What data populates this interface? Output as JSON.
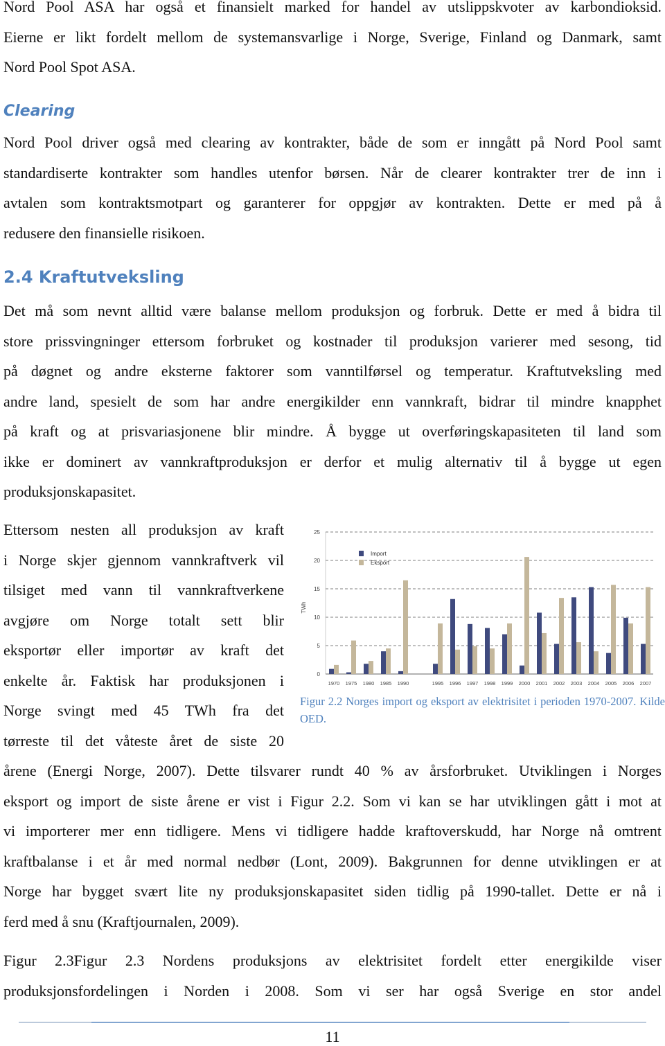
{
  "paragraphs": {
    "p1": [
      "Nord Pool ASA har også et finansielt marked for handel av utslippskvoter av karbondioksid.",
      "Eierne er likt fordelt mellom de systemansvarlige i Norge, Sverige, Finland og Danmark, samt",
      "Nord Pool Spot ASA."
    ],
    "h_clearing": "Clearing",
    "p2": [
      "Nord Pool driver også med clearing av kontrakter, både de som er inngått på Nord Pool samt",
      "standardiserte kontrakter som handles utenfor børsen. Når de clearer kontrakter trer de inn i",
      "avtalen som kontraktsmotpart og garanterer for oppgjør av kontrakten. Dette er med på å",
      "redusere den finansielle risikoen."
    ],
    "h_section": "2.4 Kraftutveksling",
    "p3": [
      "Det må som nevnt alltid være balanse mellom produksjon og forbruk. Dette er med å bidra til",
      "store prissvingninger ettersom forbruket og kostnader til produksjon varierer med sesong, tid",
      "på døgnet og andre eksterne faktorer som vanntilførsel og temperatur. Kraftutveksling med",
      "andre land, spesielt de som har andre energikilder enn vannkraft, bidrar til mindre knapphet",
      "på kraft og at prisvariasjonene blir mindre. Å bygge ut overføringskapasiteten til land som",
      "ikke er dominert av vannkraftproduksjon er derfor et mulig alternativ til å bygge ut egen",
      "produksjonskapasitet."
    ],
    "p4_narrow": [
      "Ettersom nesten all produksjon av kraft",
      "i Norge skjer gjennom vannkraftverk vil",
      "tilsiget med vann til vannkraftverkene",
      "avgjøre om Norge totalt sett blir",
      "eksportør eller importør av kraft det",
      "enkelte år. Faktisk har produksjonen i",
      "Norge svingt med 45 TWh fra det",
      "tørreste til det våteste året de siste 20"
    ],
    "p4_full": [
      "årene (Energi Norge, 2007). Dette tilsvarer rundt 40 % av årsforbruket. Utviklingen i Norges",
      "eksport og import de siste årene er vist i Figur 2.2. Som vi kan se har utviklingen gått i mot at",
      "vi importerer mer enn tidligere. Mens vi tidligere hadde kraftoverskudd, har Norge nå omtrent",
      "kraftbalanse i et år med normal nedbør (Lont, 2009). Bakgrunnen for denne utviklingen er at",
      "Norge har bygget svært lite ny produksjonskapasitet siden tidlig på 1990-tallet. Dette er nå i",
      "ferd med å snu (Kraftjournalen, 2009)."
    ],
    "p5": [
      "Figur 2.3Figur 2.3 Nordens produksjons av elektrisitet fordelt etter energikilde viser",
      "produksjonsfordelingen i Norden i 2008. Som vi ser har også Sverige en stor andel"
    ]
  },
  "figure_caption": "Figur 2.2 Norges import og eksport av elektrisitet i perioden 1970-2007. Kilde OED.",
  "page_number": "11",
  "chart_data": {
    "type": "bar",
    "title": "",
    "xlabel": "",
    "ylabel": "TWh",
    "ylim": [
      0,
      25
    ],
    "yticks": [
      "0",
      "5",
      "10",
      "15",
      "20",
      "25"
    ],
    "grid": "horizontal dashed",
    "legend": "top-left",
    "categories": [
      "1970",
      "1975",
      "1980",
      "1985",
      "1990",
      "1995",
      "1996",
      "1997",
      "1998",
      "1999",
      "2000",
      "2001",
      "2002",
      "2003",
      "2004",
      "2005",
      "2006",
      "2007"
    ],
    "series": [
      {
        "name": "Import",
        "color": "#3f4a7e",
        "values": [
          0.9,
          0.3,
          1.8,
          4.0,
          0.5,
          1.8,
          13.2,
          8.8,
          8.1,
          7.0,
          1.5,
          10.8,
          5.3,
          13.5,
          15.3,
          3.7,
          9.9,
          5.3
        ]
      },
      {
        "name": "Eksport",
        "color": "#c4b79b",
        "values": [
          1.6,
          5.9,
          2.3,
          4.5,
          16.5,
          8.9,
          4.3,
          4.9,
          4.5,
          8.9,
          20.6,
          7.2,
          13.4,
          5.6,
          4.0,
          15.7,
          8.9,
          15.3
        ]
      }
    ]
  },
  "colors": {
    "heading": "#4f81bd",
    "caption": "#4f81bd"
  }
}
